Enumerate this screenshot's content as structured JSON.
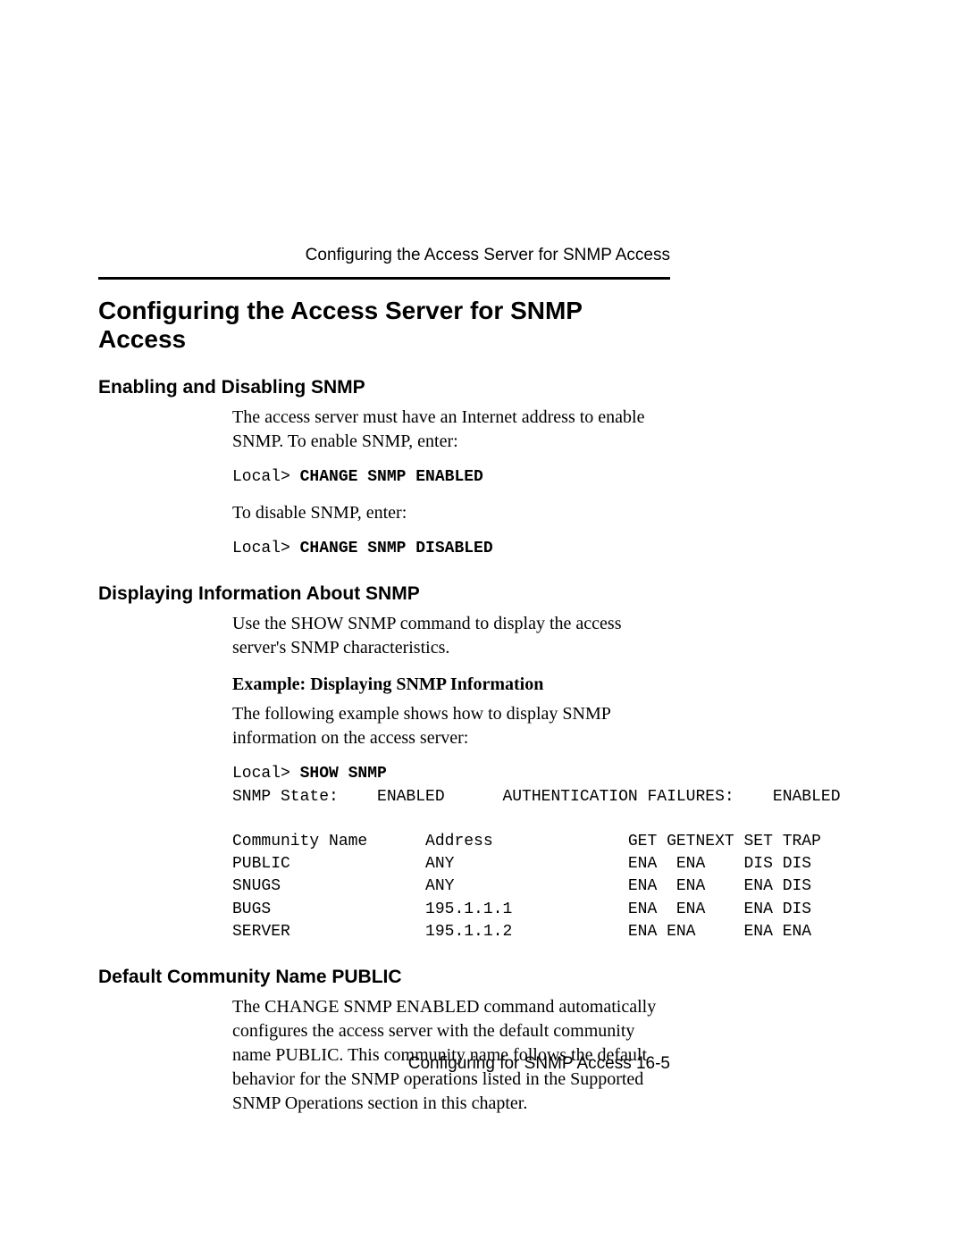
{
  "running_header": "Configuring the Access Server for SNMP Access",
  "section_title": "Configuring the Access Server for SNMP Access",
  "sub1": {
    "heading": "Enabling and Disabling SNMP",
    "p1": "The access server must have an Internet address to enable SNMP. To enable SNMP, enter:",
    "code1_prompt": "Local> ",
    "code1_cmd": "CHANGE SNMP ENABLED",
    "p2": "To disable SNMP, enter:",
    "code2_prompt": "Local> ",
    "code2_cmd": "CHANGE SNMP DISABLED"
  },
  "sub2": {
    "heading": "Displaying Information About SNMP",
    "p1": "Use the SHOW SNMP command to display the access server's SNMP characteristics.",
    "example_heading": "Example: Displaying SNMP Information",
    "p2": "The following example shows how to display SNMP information on the access server:",
    "code_prompt": "Local> ",
    "code_cmd": "SHOW SNMP",
    "output": "\nSNMP State:    ENABLED      AUTHENTICATION FAILURES:    ENABLED\n\nCommunity Name      Address              GET GETNEXT SET TRAP\nPUBLIC              ANY                  ENA  ENA    DIS DIS\nSNUGS               ANY                  ENA  ENA    ENA DIS\nBUGS                195.1.1.1            ENA  ENA    ENA DIS\nSERVER              195.1.1.2            ENA ENA     ENA ENA"
  },
  "sub3": {
    "heading": "Default Community Name PUBLIC",
    "p1": "The CHANGE SNMP ENABLED command automatically configures the access server with the default community name PUBLIC. This community name follows the default behavior for the SNMP operations listed in the Supported SNMP Operations section in this chapter."
  },
  "footer": "Configuring for SNMP Access 16-5"
}
